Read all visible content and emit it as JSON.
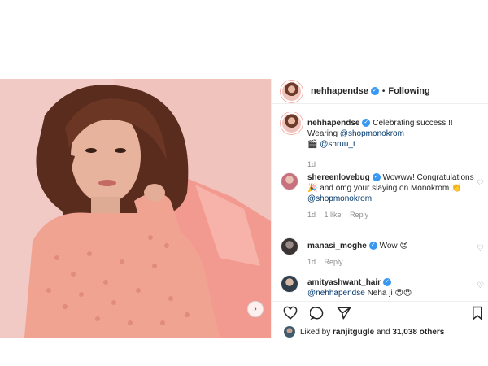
{
  "post": {
    "author": "nehhapendse",
    "follow_status": "Following",
    "separator": "•"
  },
  "caption": {
    "author": "nehhapendse",
    "text_1": "Celebrating success !!",
    "text_2": "Wearing",
    "mention_1": "@shopmonokrom",
    "emoji": "🎬",
    "mention_2": "@shruu_t",
    "time": "1d"
  },
  "comments": [
    {
      "author": "shereenlovebug",
      "text": "Wowww! Congratulations 🎉 and omg your slaying on Monokrom 👏",
      "mention": "@shopmonokrom",
      "time": "1d",
      "likes": "1 like",
      "reply": "Reply"
    },
    {
      "author": "manasi_moghe",
      "text": "Wow 😍",
      "time": "1d",
      "reply": "Reply"
    },
    {
      "author": "amityashwant_hair",
      "mention": "@nehhapendse",
      "text": "Neha ji 😍😍"
    }
  ],
  "likes": {
    "prefix": "Liked by",
    "user": "ranjitgugle",
    "middle": "and",
    "others": "31,038 others"
  },
  "icons": {
    "like": "heart-icon",
    "comment": "comment-icon",
    "share": "share-icon",
    "save": "bookmark-icon",
    "next": "chevron-right-icon"
  },
  "colors": {
    "verified": "#3897f0",
    "mention": "#00376b",
    "muted": "#8e8e8e"
  }
}
